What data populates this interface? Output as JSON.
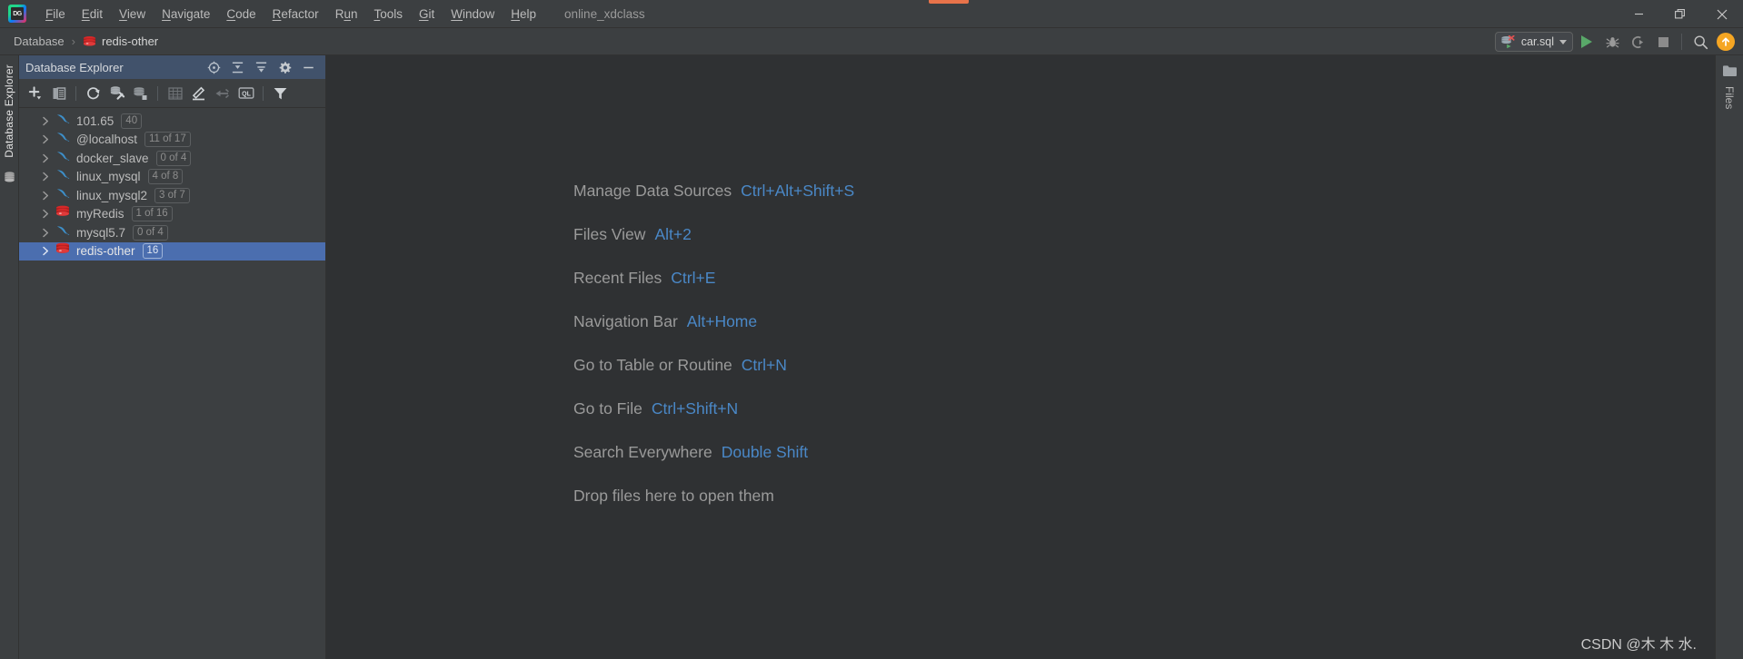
{
  "window": {
    "project_name": "online_xdclass",
    "minimize_label": "—",
    "restore_label": "Restore",
    "close_label": "×"
  },
  "menu": {
    "items": [
      {
        "label": "File",
        "mnemonic": "F"
      },
      {
        "label": "Edit",
        "mnemonic": "E"
      },
      {
        "label": "View",
        "mnemonic": "V"
      },
      {
        "label": "Navigate",
        "mnemonic": "N"
      },
      {
        "label": "Code",
        "mnemonic": "C"
      },
      {
        "label": "Refactor",
        "mnemonic": "R"
      },
      {
        "label": "Run",
        "mnemonic": "R"
      },
      {
        "label": "Tools",
        "mnemonic": "T"
      },
      {
        "label": "Git",
        "mnemonic": "G"
      },
      {
        "label": "Window",
        "mnemonic": "W"
      },
      {
        "label": "Help",
        "mnemonic": "H"
      }
    ]
  },
  "breadcrumb": {
    "root": "Database",
    "separator": "›",
    "current": "redis-other"
  },
  "run_toolbar": {
    "config_name": "car.sql",
    "run_label": "Run",
    "debug_label": "Debug",
    "run_with_coverage_label": "Run with Coverage",
    "stop_label": "Stop",
    "search_label": "Search Everywhere",
    "update_label": "Update"
  },
  "left_strip": {
    "tool_window": "Database Explorer",
    "db_icon_label": "database-icon"
  },
  "right_strip": {
    "files_tab": "Files"
  },
  "sidebar": {
    "title": "Database Explorer",
    "header_buttons": [
      {
        "name": "locate-icon",
        "label": "Select Opened File"
      },
      {
        "name": "expand-all-icon",
        "label": "Expand All"
      },
      {
        "name": "collapse-all-icon",
        "label": "Collapse All"
      },
      {
        "name": "gear-icon",
        "label": "Options"
      },
      {
        "name": "minimize-icon",
        "label": "Hide"
      }
    ],
    "toolbar_buttons": [
      {
        "name": "add-icon",
        "label": "New"
      },
      {
        "name": "duplicate-icon",
        "label": "Duplicate"
      },
      {
        "name": "refresh-icon",
        "label": "Refresh"
      },
      {
        "name": "datasource-properties-icon",
        "label": "Data Source Properties"
      },
      {
        "name": "database-stack-icon",
        "label": "Database Tools"
      },
      {
        "name": "table-grid-icon",
        "label": "Open Table Editor"
      },
      {
        "name": "modify-icon",
        "label": "Modify"
      },
      {
        "name": "jump-to-icon",
        "label": "Jump to Query Console"
      },
      {
        "name": "ql-console-icon",
        "label": "Open Console"
      },
      {
        "name": "filter-icon",
        "label": "Filter"
      }
    ],
    "tree": [
      {
        "label": "101.65",
        "badge": "40",
        "icon": "mysql-dolphin-icon",
        "selected": false
      },
      {
        "label": "@localhost",
        "badge": "11 of 17",
        "icon": "mysql-dolphin-icon",
        "selected": false
      },
      {
        "label": "docker_slave",
        "badge": "0 of 4",
        "icon": "mysql-dolphin-icon",
        "selected": false
      },
      {
        "label": "linux_mysql",
        "badge": "4 of 8",
        "icon": "mysql-dolphin-icon",
        "selected": false
      },
      {
        "label": "linux_mysql2",
        "badge": "3 of 7",
        "icon": "mysql-dolphin-icon",
        "selected": false
      },
      {
        "label": "myRedis",
        "badge": "1 of 16",
        "icon": "redis-icon",
        "selected": false
      },
      {
        "label": "mysql5.7",
        "badge": "0 of 4",
        "icon": "mysql-dolphin-icon",
        "selected": false
      },
      {
        "label": "redis-other",
        "badge": "16",
        "icon": "redis-icon",
        "selected": true
      }
    ]
  },
  "editor": {
    "shortcuts": [
      {
        "label": "Manage Data Sources",
        "key": "Ctrl+Alt+Shift+S"
      },
      {
        "label": "Files View",
        "key": "Alt+2"
      },
      {
        "label": "Recent Files",
        "key": "Ctrl+E"
      },
      {
        "label": "Navigation Bar",
        "key": "Alt+Home"
      },
      {
        "label": "Go to Table or Routine",
        "key": "Ctrl+N"
      },
      {
        "label": "Go to File",
        "key": "Ctrl+Shift+N"
      },
      {
        "label": "Search Everywhere",
        "key": "Double Shift"
      },
      {
        "label": "Drop files here to open them",
        "key": ""
      }
    ],
    "watermark": "CSDN @木 木 水."
  },
  "colors": {
    "accent_blue": "#4a88c7",
    "selection_blue": "#4b6eaf",
    "panel_header_blue": "#41526b",
    "chrome_bg": "#3c3f41",
    "editor_bg": "#2f3133",
    "redis_red": "#d62828",
    "mysql_blue": "#3d8fc9",
    "run_green": "#59a869",
    "update_orange": "#f5a623"
  }
}
